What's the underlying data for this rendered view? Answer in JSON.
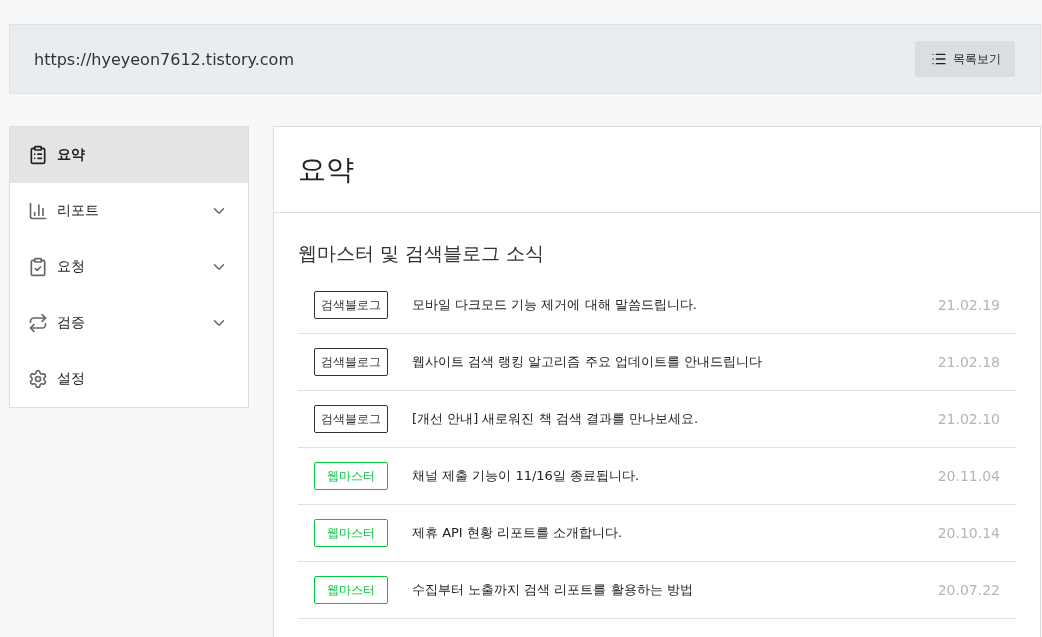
{
  "header": {
    "url": "https://hyeyeon7612.tistory.com",
    "list_button": "목록보기"
  },
  "sidebar": {
    "items": [
      {
        "label": "요약",
        "kind": "link",
        "selected": true
      },
      {
        "label": "리포트",
        "kind": "group",
        "selected": false
      },
      {
        "label": "요청",
        "kind": "group",
        "selected": false
      },
      {
        "label": "검증",
        "kind": "group",
        "selected": false
      },
      {
        "label": "설정",
        "kind": "link",
        "selected": false
      }
    ]
  },
  "main": {
    "title": "요약",
    "section_title": "웹마스터 및 검색블로그 소식",
    "news": [
      {
        "tag": "검색블로그",
        "color": "#333333",
        "title": "모바일 다크모드 기능 제거에 대해 말씀드립니다.",
        "date": "21.02.19"
      },
      {
        "tag": "검색블로그",
        "color": "#333333",
        "title": "웹사이트 검색 랭킹 알고리즘 주요 업데이트를 안내드립니다",
        "date": "21.02.18"
      },
      {
        "tag": "검색블로그",
        "color": "#333333",
        "title": "[개선 안내] 새로워진 책 검색 결과를 만나보세요.",
        "date": "21.02.10"
      },
      {
        "tag": "웹마스터",
        "color": "#00c73c",
        "title": "채널 제출 기능이 11/16일 종료됩니다.",
        "date": "20.11.04"
      },
      {
        "tag": "웹마스터",
        "color": "#00c73c",
        "title": "제휴 API 현황 리포트를 소개합니다.",
        "date": "20.10.14"
      },
      {
        "tag": "웹마스터",
        "color": "#00c73c",
        "title": "수집부터 노출까지 검색 리포트를 활용하는 방법",
        "date": "20.07.22"
      }
    ]
  }
}
